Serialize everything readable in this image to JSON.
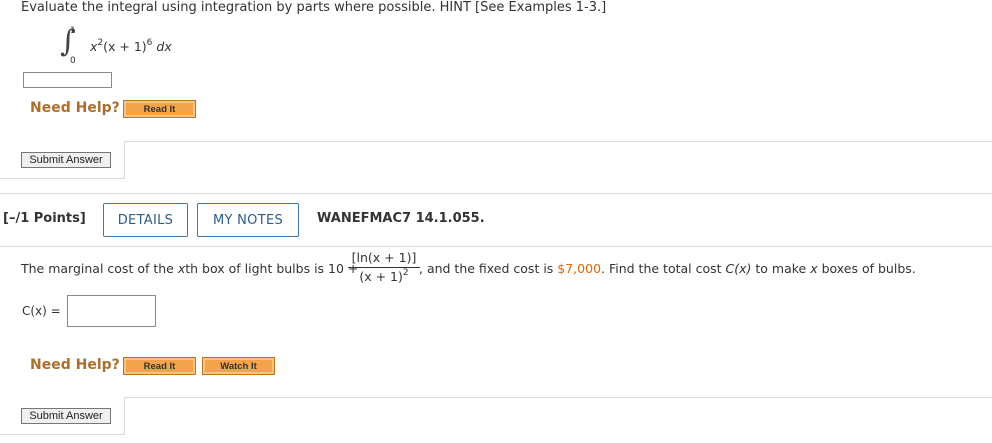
{
  "q1": {
    "prompt": "Evaluate the integral using integration by parts where possible. HINT [See Examples 1-3.]",
    "integral": {
      "sign": "∫",
      "upper_limit": "1",
      "lower_limit": "0",
      "integrand_x": "x",
      "integrand_x_exp": "2",
      "integrand_paren": "(x + 1)",
      "integrand_paren_exp": "6",
      "differential": "dx"
    },
    "answer_value": "",
    "need_help_label": "Need Help?",
    "read_it_label": "Read It",
    "submit_label": "Submit Answer"
  },
  "q2": {
    "points_label": "[–/1 Points]",
    "details_label": "DETAILS",
    "my_notes_label": "MY NOTES",
    "problem_id": "WANEFMAC7 14.1.055.",
    "text_part1": "The marginal cost of the ",
    "text_x": "x",
    "text_part2": "th box of light bulbs is 10 +",
    "fraction_numerator": "[ln(x + 1)]",
    "fraction_denominator": "(x + 1)",
    "fraction_denominator_exp": "2",
    "text_part3": ", and the fixed cost is ",
    "fixed_cost": "$7,000",
    "text_part4": ". Find the total cost ",
    "cost_func": "C(x)",
    "text_part5": " to make ",
    "text_x2": "x",
    "text_part6": " boxes of bulbs.",
    "answer_label": "C(x) =",
    "answer_value": "",
    "need_help_label": "Need Help?",
    "read_it_label": "Read It",
    "watch_it_label": "Watch It",
    "submit_label": "Submit Answer"
  },
  "colors": {
    "accent_orange": "#e06a00",
    "help_brown": "#ad6e2b",
    "tab_blue": "#2c5d8f",
    "button_orange": "#f3a348"
  }
}
